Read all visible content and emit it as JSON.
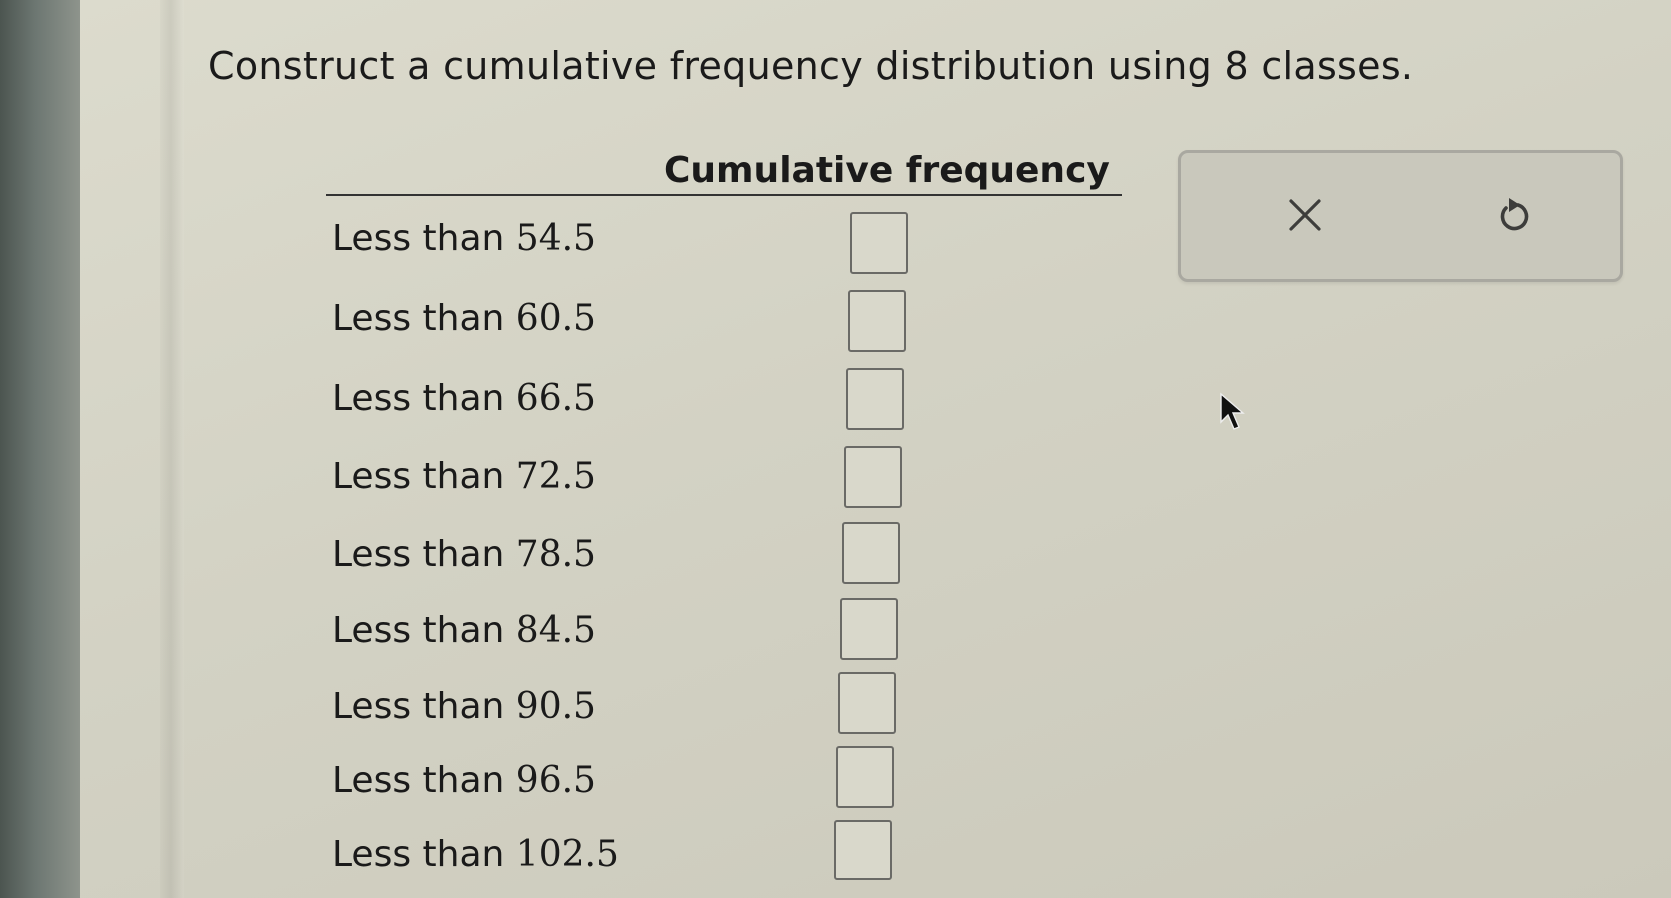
{
  "question": {
    "text": "Construct a cumulative frequency distribution using 8 classes."
  },
  "table": {
    "header": "Cumulative frequency",
    "rows": [
      {
        "prefix": "Less than",
        "value": "54.5",
        "input": ""
      },
      {
        "prefix": "Less than",
        "value": "60.5",
        "input": ""
      },
      {
        "prefix": "Less than",
        "value": "66.5",
        "input": ""
      },
      {
        "prefix": "Less than",
        "value": "72.5",
        "input": ""
      },
      {
        "prefix": "Less than",
        "value": "78.5",
        "input": ""
      },
      {
        "prefix": "Less than",
        "value": "84.5",
        "input": ""
      },
      {
        "prefix": "Less than",
        "value": "90.5",
        "input": ""
      },
      {
        "prefix": "Less than",
        "value": "96.5",
        "input": ""
      },
      {
        "prefix": "Less than",
        "value": "102.5",
        "input": ""
      }
    ]
  },
  "toolbar": {
    "clear_icon": "x-icon",
    "undo_icon": "undo-icon"
  },
  "colors": {
    "page_background": "#d6d5c7",
    "text": "#1a1a1a",
    "input_border": "#6a6a66",
    "toolbar_background": "#c9c8bc"
  }
}
